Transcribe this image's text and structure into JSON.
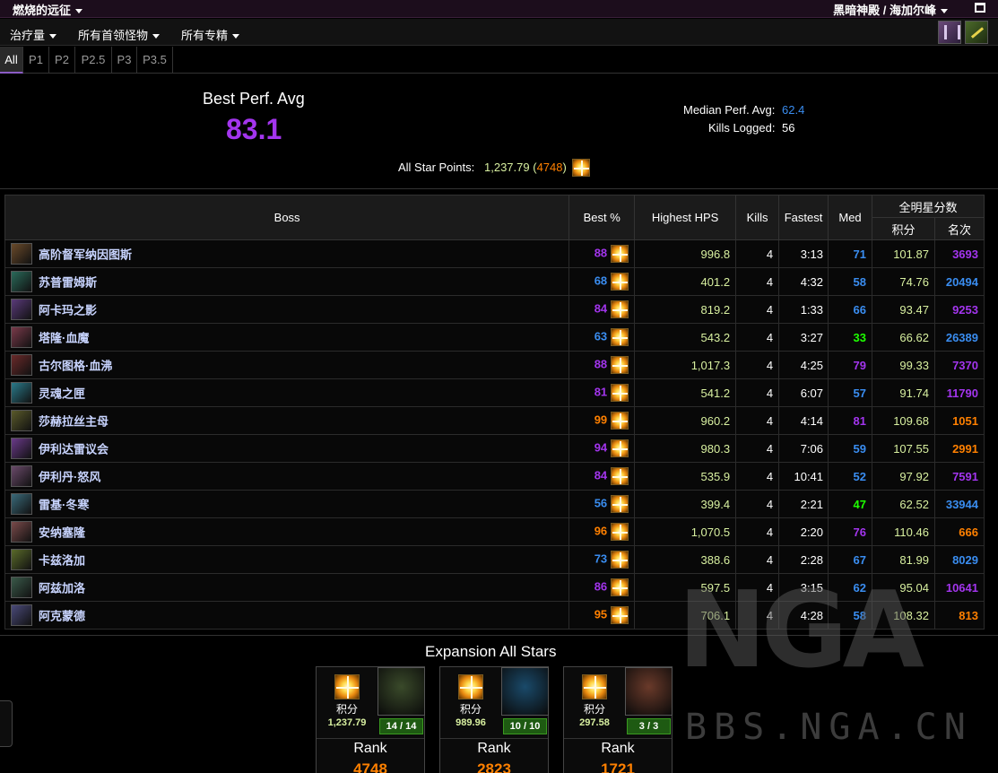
{
  "topbar": {
    "title": "燃烧的远征",
    "server": "黑暗神殿 / 海加尔峰"
  },
  "menu": {
    "metric": "治疗量",
    "bosses": "所有首领怪物",
    "specs": "所有专精"
  },
  "phases": [
    "All",
    "P1",
    "P2",
    "P2.5",
    "P3",
    "P3.5"
  ],
  "summary": {
    "best_label": "Best Perf. Avg",
    "best_value": "83.1",
    "median_label": "Median Perf. Avg:",
    "median_value": "62.4",
    "kills_label": "Kills Logged:",
    "kills_value": "56",
    "star_label": "All Star Points:",
    "star_points": "1,237.79",
    "star_rank": "4748",
    "paren_open": "(",
    "paren_close": ")"
  },
  "table": {
    "headers": {
      "boss": "Boss",
      "best": "Best %",
      "hps": "Highest HPS",
      "kills": "Kills",
      "fastest": "Fastest",
      "med": "Med",
      "allstar": "全明星分数",
      "points": "积分",
      "rank": "名次"
    },
    "rows": [
      {
        "name": "高阶督军纳因图斯",
        "best": "88",
        "best_q": "epic",
        "hps": "996.8",
        "kills": "4",
        "fastest": "3:13",
        "med": "71",
        "med_q": "rare",
        "points": "101.87",
        "rank": "3693",
        "rank_q": "epic",
        "icon": "#6a4a2a"
      },
      {
        "name": "苏普雷姆斯",
        "best": "68",
        "best_q": "rare",
        "hps": "401.2",
        "kills": "4",
        "fastest": "4:32",
        "med": "58",
        "med_q": "rare",
        "points": "74.76",
        "rank": "20494",
        "rank_q": "rare",
        "icon": "#2a6a5a"
      },
      {
        "name": "阿卡玛之影",
        "best": "84",
        "best_q": "epic",
        "hps": "819.2",
        "kills": "4",
        "fastest": "1:33",
        "med": "66",
        "med_q": "rare",
        "points": "93.47",
        "rank": "9253",
        "rank_q": "epic",
        "icon": "#5a3a7a"
      },
      {
        "name": "塔隆·血魔",
        "best": "63",
        "best_q": "rare",
        "hps": "543.2",
        "kills": "4",
        "fastest": "3:27",
        "med": "33",
        "med_q": "uncommon",
        "points": "66.62",
        "rank": "26389",
        "rank_q": "rare",
        "icon": "#7a3a4a"
      },
      {
        "name": "古尔图格·血沸",
        "best": "88",
        "best_q": "epic",
        "hps": "1,017.3",
        "kills": "4",
        "fastest": "4:25",
        "med": "79",
        "med_q": "epic",
        "points": "99.33",
        "rank": "7370",
        "rank_q": "epic",
        "icon": "#6a2a2a"
      },
      {
        "name": "灵魂之匣",
        "best": "81",
        "best_q": "epic",
        "hps": "541.2",
        "kills": "4",
        "fastest": "6:07",
        "med": "57",
        "med_q": "rare",
        "points": "91.74",
        "rank": "11790",
        "rank_q": "epic",
        "icon": "#2a7a8a"
      },
      {
        "name": "莎赫拉丝主母",
        "best": "99",
        "best_q": "legendary",
        "hps": "960.2",
        "kills": "4",
        "fastest": "4:14",
        "med": "81",
        "med_q": "epic",
        "points": "109.68",
        "rank": "1051",
        "rank_q": "legendary",
        "icon": "#5a5a2a"
      },
      {
        "name": "伊利达雷议会",
        "best": "94",
        "best_q": "epic",
        "hps": "980.3",
        "kills": "4",
        "fastest": "7:06",
        "med": "59",
        "med_q": "rare",
        "points": "107.55",
        "rank": "2991",
        "rank_q": "legendary",
        "icon": "#6a3a8a"
      },
      {
        "name": "伊利丹·怒风",
        "best": "84",
        "best_q": "epic",
        "hps": "535.9",
        "kills": "4",
        "fastest": "10:41",
        "med": "52",
        "med_q": "rare",
        "points": "97.92",
        "rank": "7591",
        "rank_q": "epic",
        "icon": "#6a4a6a"
      },
      {
        "name": "雷基·冬寒",
        "best": "56",
        "best_q": "rare",
        "hps": "399.4",
        "kills": "4",
        "fastest": "2:21",
        "med": "47",
        "med_q": "uncommon",
        "points": "62.52",
        "rank": "33944",
        "rank_q": "rare",
        "icon": "#3a6a7a"
      },
      {
        "name": "安纳塞隆",
        "best": "96",
        "best_q": "legendary",
        "hps": "1,070.5",
        "kills": "4",
        "fastest": "2:20",
        "med": "76",
        "med_q": "epic",
        "points": "110.46",
        "rank": "666",
        "rank_q": "legendary",
        "icon": "#7a4a4a"
      },
      {
        "name": "卡兹洛加",
        "best": "73",
        "best_q": "rare",
        "hps": "388.6",
        "kills": "4",
        "fastest": "2:28",
        "med": "67",
        "med_q": "rare",
        "points": "81.99",
        "rank": "8029",
        "rank_q": "rare",
        "icon": "#5a6a2a"
      },
      {
        "name": "阿兹加洛",
        "best": "86",
        "best_q": "epic",
        "hps": "597.5",
        "kills": "4",
        "fastest": "3:15",
        "med": "62",
        "med_q": "rare",
        "points": "95.04",
        "rank": "10641",
        "rank_q": "epic",
        "icon": "#3a5a4a"
      },
      {
        "name": "阿克蒙德",
        "best": "95",
        "best_q": "legendary",
        "hps": "706.1",
        "kills": "4",
        "fastest": "4:28",
        "med": "58",
        "med_q": "rare",
        "points": "108.32",
        "rank": "813",
        "rank_q": "legendary",
        "icon": "#4a4a7a"
      }
    ]
  },
  "expansion": {
    "title": "Expansion All Stars",
    "cards": [
      {
        "points_label": "积分",
        "points": "1,237.79",
        "kills": "14 / 14",
        "rank_label": "Rank",
        "rank": "4748",
        "img": "#3a4a2a"
      },
      {
        "points_label": "积分",
        "points": "989.96",
        "kills": "10 / 10",
        "rank_label": "Rank",
        "rank": "2823",
        "img": "#1a4a6a"
      },
      {
        "points_label": "积分",
        "points": "297.58",
        "kills": "3 / 3",
        "rank_label": "Rank",
        "rank": "1721",
        "img": "#6a3a2a"
      }
    ]
  },
  "watermark": {
    "logo": "NGA",
    "text": "BBS.NGA.CN"
  }
}
